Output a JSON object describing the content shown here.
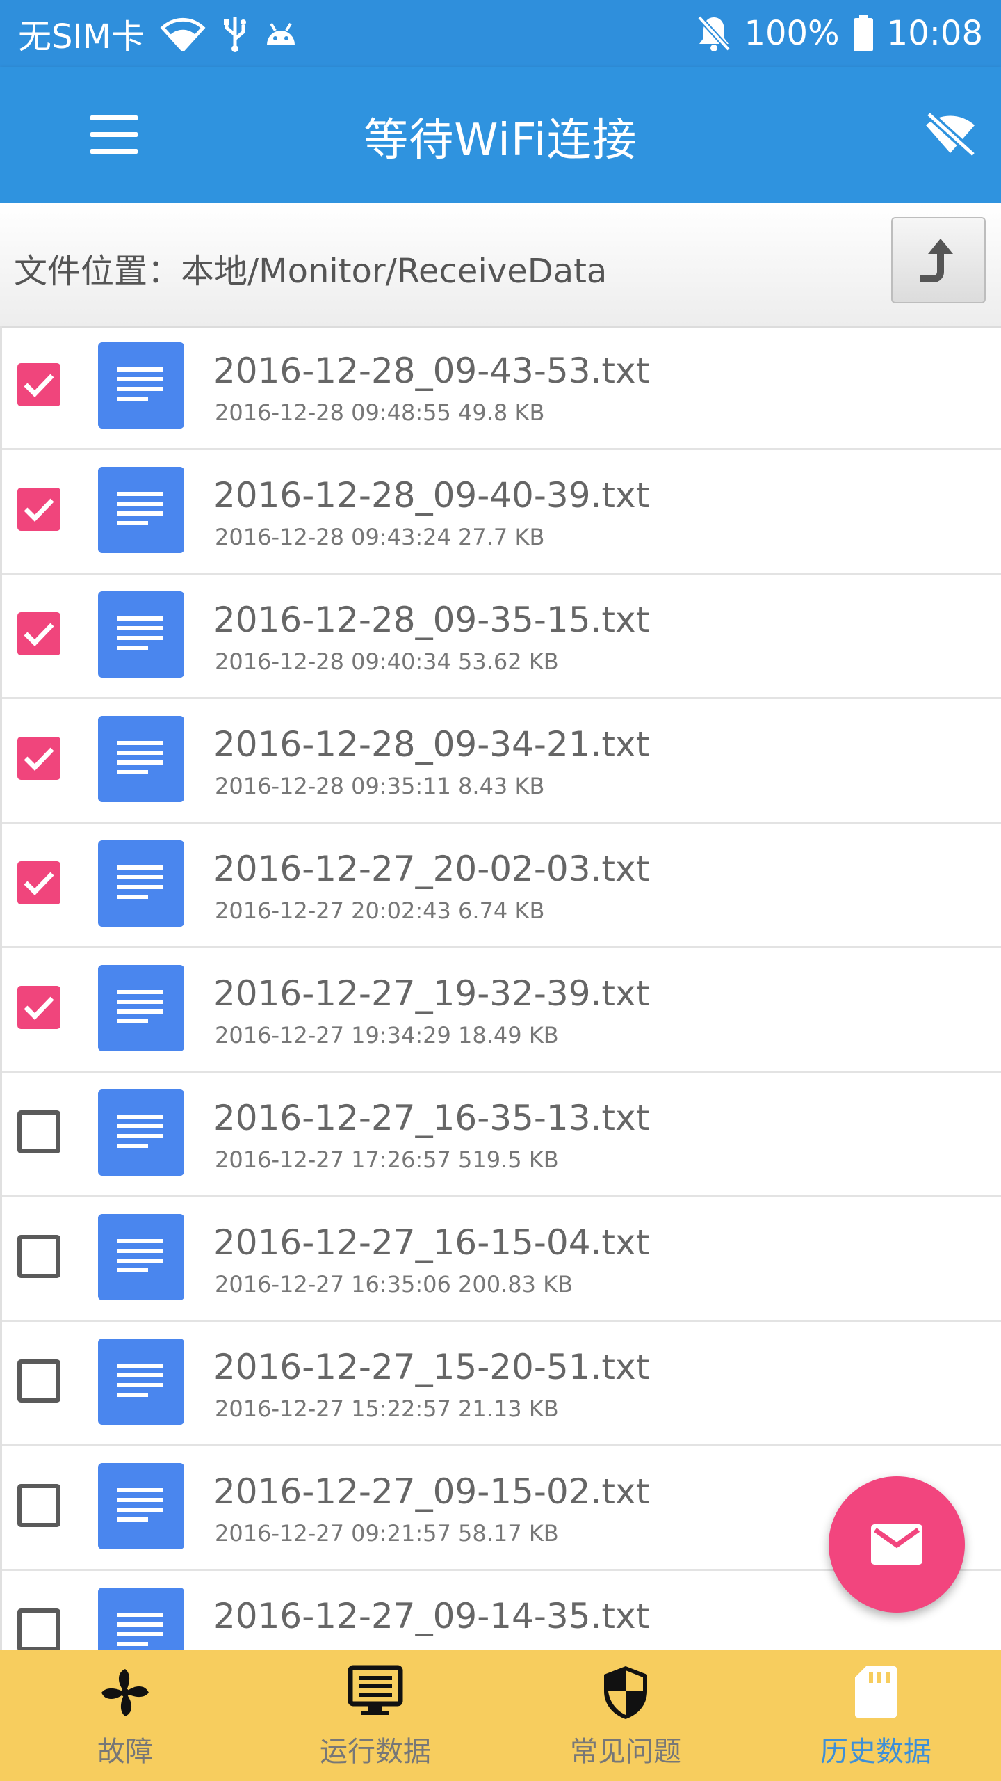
{
  "status_bar": {
    "carrier": "无SIM卡",
    "battery": "100%",
    "time": "10:08"
  },
  "app_bar": {
    "title": "等待WiFi连接"
  },
  "path_bar": {
    "label": "文件位置：本地/Monitor/ReceiveData"
  },
  "files": [
    {
      "name": "2016-12-28_09-43-53.txt",
      "meta": "2016-12-28  09:48:55  49.8 KB",
      "checked": true
    },
    {
      "name": "2016-12-28_09-40-39.txt",
      "meta": "2016-12-28  09:43:24  27.7 KB",
      "checked": true
    },
    {
      "name": "2016-12-28_09-35-15.txt",
      "meta": "2016-12-28  09:40:34  53.62 KB",
      "checked": true
    },
    {
      "name": "2016-12-28_09-34-21.txt",
      "meta": "2016-12-28  09:35:11  8.43 KB",
      "checked": true
    },
    {
      "name": "2016-12-27_20-02-03.txt",
      "meta": "2016-12-27  20:02:43  6.74 KB",
      "checked": true
    },
    {
      "name": "2016-12-27_19-32-39.txt",
      "meta": "2016-12-27  19:34:29  18.49 KB",
      "checked": true
    },
    {
      "name": "2016-12-27_16-35-13.txt",
      "meta": "2016-12-27  17:26:57  519.5 KB",
      "checked": false
    },
    {
      "name": "2016-12-27_16-15-04.txt",
      "meta": "2016-12-27  16:35:06  200.83 KB",
      "checked": false
    },
    {
      "name": "2016-12-27_15-20-51.txt",
      "meta": "2016-12-27  15:22:57  21.13 KB",
      "checked": false
    },
    {
      "name": "2016-12-27_09-15-02.txt",
      "meta": "2016-12-27  09:21:57  58.17 KB",
      "checked": false
    },
    {
      "name": "2016-12-27_09-14-35.txt",
      "meta": "",
      "checked": false
    }
  ],
  "bottom_nav": [
    {
      "label": "故障",
      "icon": "fan-icon",
      "active": false
    },
    {
      "label": "运行数据",
      "icon": "monitor-icon",
      "active": false
    },
    {
      "label": "常见问题",
      "icon": "shield-icon",
      "active": false
    },
    {
      "label": "历史数据",
      "icon": "sd-card-icon",
      "active": true
    }
  ],
  "colors": {
    "primary": "#2f93df",
    "accent": "#f0457c",
    "file_icon": "#4a86ee",
    "bottom_nav_bg": "#f7cd5e",
    "active_tab": "#3d8fd8"
  }
}
